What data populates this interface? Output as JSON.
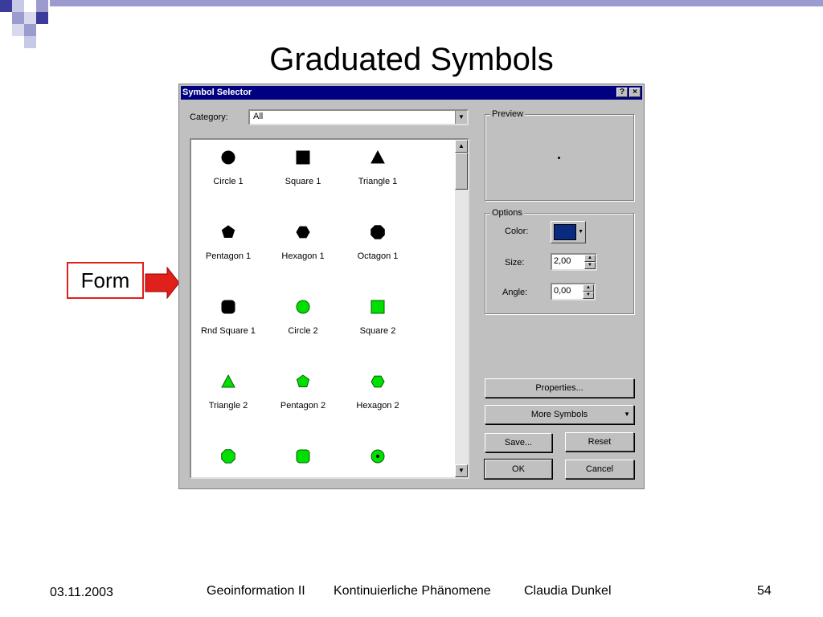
{
  "slide": {
    "title": "Graduated Symbols",
    "callout": "Form",
    "footer": {
      "date": "03.11.2003",
      "course": "Geoinformation II",
      "topic": "Kontinuierliche Phänomene",
      "author": "Claudia Dunkel",
      "page": "54"
    },
    "colors": {
      "deco": "#9b9bcf",
      "arrow": "#e0201a"
    }
  },
  "dialog": {
    "title": "Symbol Selector",
    "help_button": "?",
    "close_button": "×",
    "category_label": "Category:",
    "category_value": "All",
    "symbols": [
      {
        "label": "Circle 1",
        "shape": "circle",
        "color": "#000000"
      },
      {
        "label": "Square 1",
        "shape": "square",
        "color": "#000000"
      },
      {
        "label": "Triangle 1",
        "shape": "triangle",
        "color": "#000000"
      },
      {
        "label": "Pentagon 1",
        "shape": "pentagon",
        "color": "#000000"
      },
      {
        "label": "Hexagon 1",
        "shape": "hexagon",
        "color": "#000000"
      },
      {
        "label": "Octagon 1",
        "shape": "octagon",
        "color": "#000000"
      },
      {
        "label": "Rnd Square 1",
        "shape": "round-square",
        "color": "#000000"
      },
      {
        "label": "Circle 2",
        "shape": "circle",
        "color": "#00e000"
      },
      {
        "label": "Square 2",
        "shape": "square",
        "color": "#00e000"
      },
      {
        "label": "Triangle 2",
        "shape": "triangle",
        "color": "#00e000"
      },
      {
        "label": "Pentagon 2",
        "shape": "pentagon",
        "color": "#00e000"
      },
      {
        "label": "Hexagon 2",
        "shape": "hexagon",
        "color": "#00e000"
      },
      {
        "label": "",
        "shape": "octagon",
        "color": "#00e000"
      },
      {
        "label": "",
        "shape": "round-square",
        "color": "#00e000"
      },
      {
        "label": "",
        "shape": "circle-dot",
        "color": "#00e000"
      }
    ],
    "preview_label": "Preview",
    "options_label": "Options",
    "color_label": "Color:",
    "color_value": "#0a2a80",
    "size_label": "Size:",
    "size_value": "2,00",
    "angle_label": "Angle:",
    "angle_value": "0,00",
    "properties_button": "Properties...",
    "more_symbols_button": "More Symbols",
    "save_button": "Save...",
    "reset_button": "Reset",
    "ok_button": "OK",
    "cancel_button": "Cancel"
  }
}
